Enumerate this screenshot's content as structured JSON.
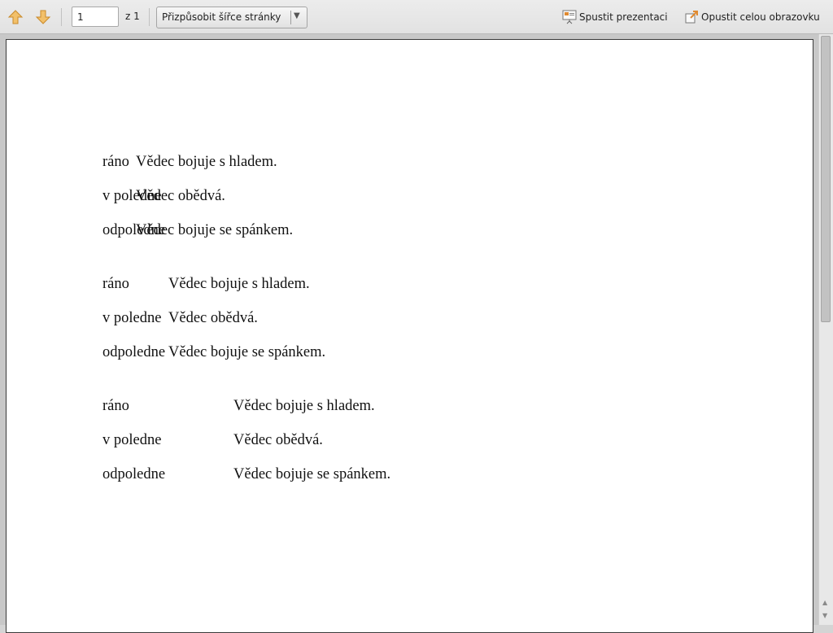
{
  "toolbar": {
    "previous_page_icon": "arrow-up-icon",
    "next_page_icon": "arrow-down-icon",
    "page_number": "1",
    "page_total": "z 1",
    "zoom_value": "Přizpůsobit šířce stránky",
    "zoom_arrow": "▼",
    "presentation_label": "Spustit prezentaci",
    "exit_fullscreen_label": "Opustit celou obrazovku"
  },
  "document": {
    "table1": {
      "rows": [
        {
          "time": "ráno",
          "text": "Vědec bojuje s hladem."
        },
        {
          "time": "v poledne",
          "text": "Vědec obědvá."
        },
        {
          "time": "odpoledne",
          "text": "Vědec bojuje se spánkem."
        }
      ]
    },
    "table2": {
      "rows": [
        {
          "time": "ráno",
          "text": "Vědec bojuje s hladem."
        },
        {
          "time": "v poledne",
          "text": "Vědec obědvá."
        },
        {
          "time": "odpoledne",
          "text": "Vědec bojuje se spánkem."
        }
      ]
    },
    "table3": {
      "rows": [
        {
          "time": "ráno",
          "text": "Vědec bojuje s hladem."
        },
        {
          "time": "v poledne",
          "text": "Vědec obědvá."
        },
        {
          "time": "odpoledne",
          "text": "Vědec bojuje se spánkem."
        }
      ]
    }
  },
  "colors": {
    "arrow_icon": "#e0a030",
    "toolbar_bg": "#e6e6e6",
    "page_bg": "#ffffff"
  }
}
